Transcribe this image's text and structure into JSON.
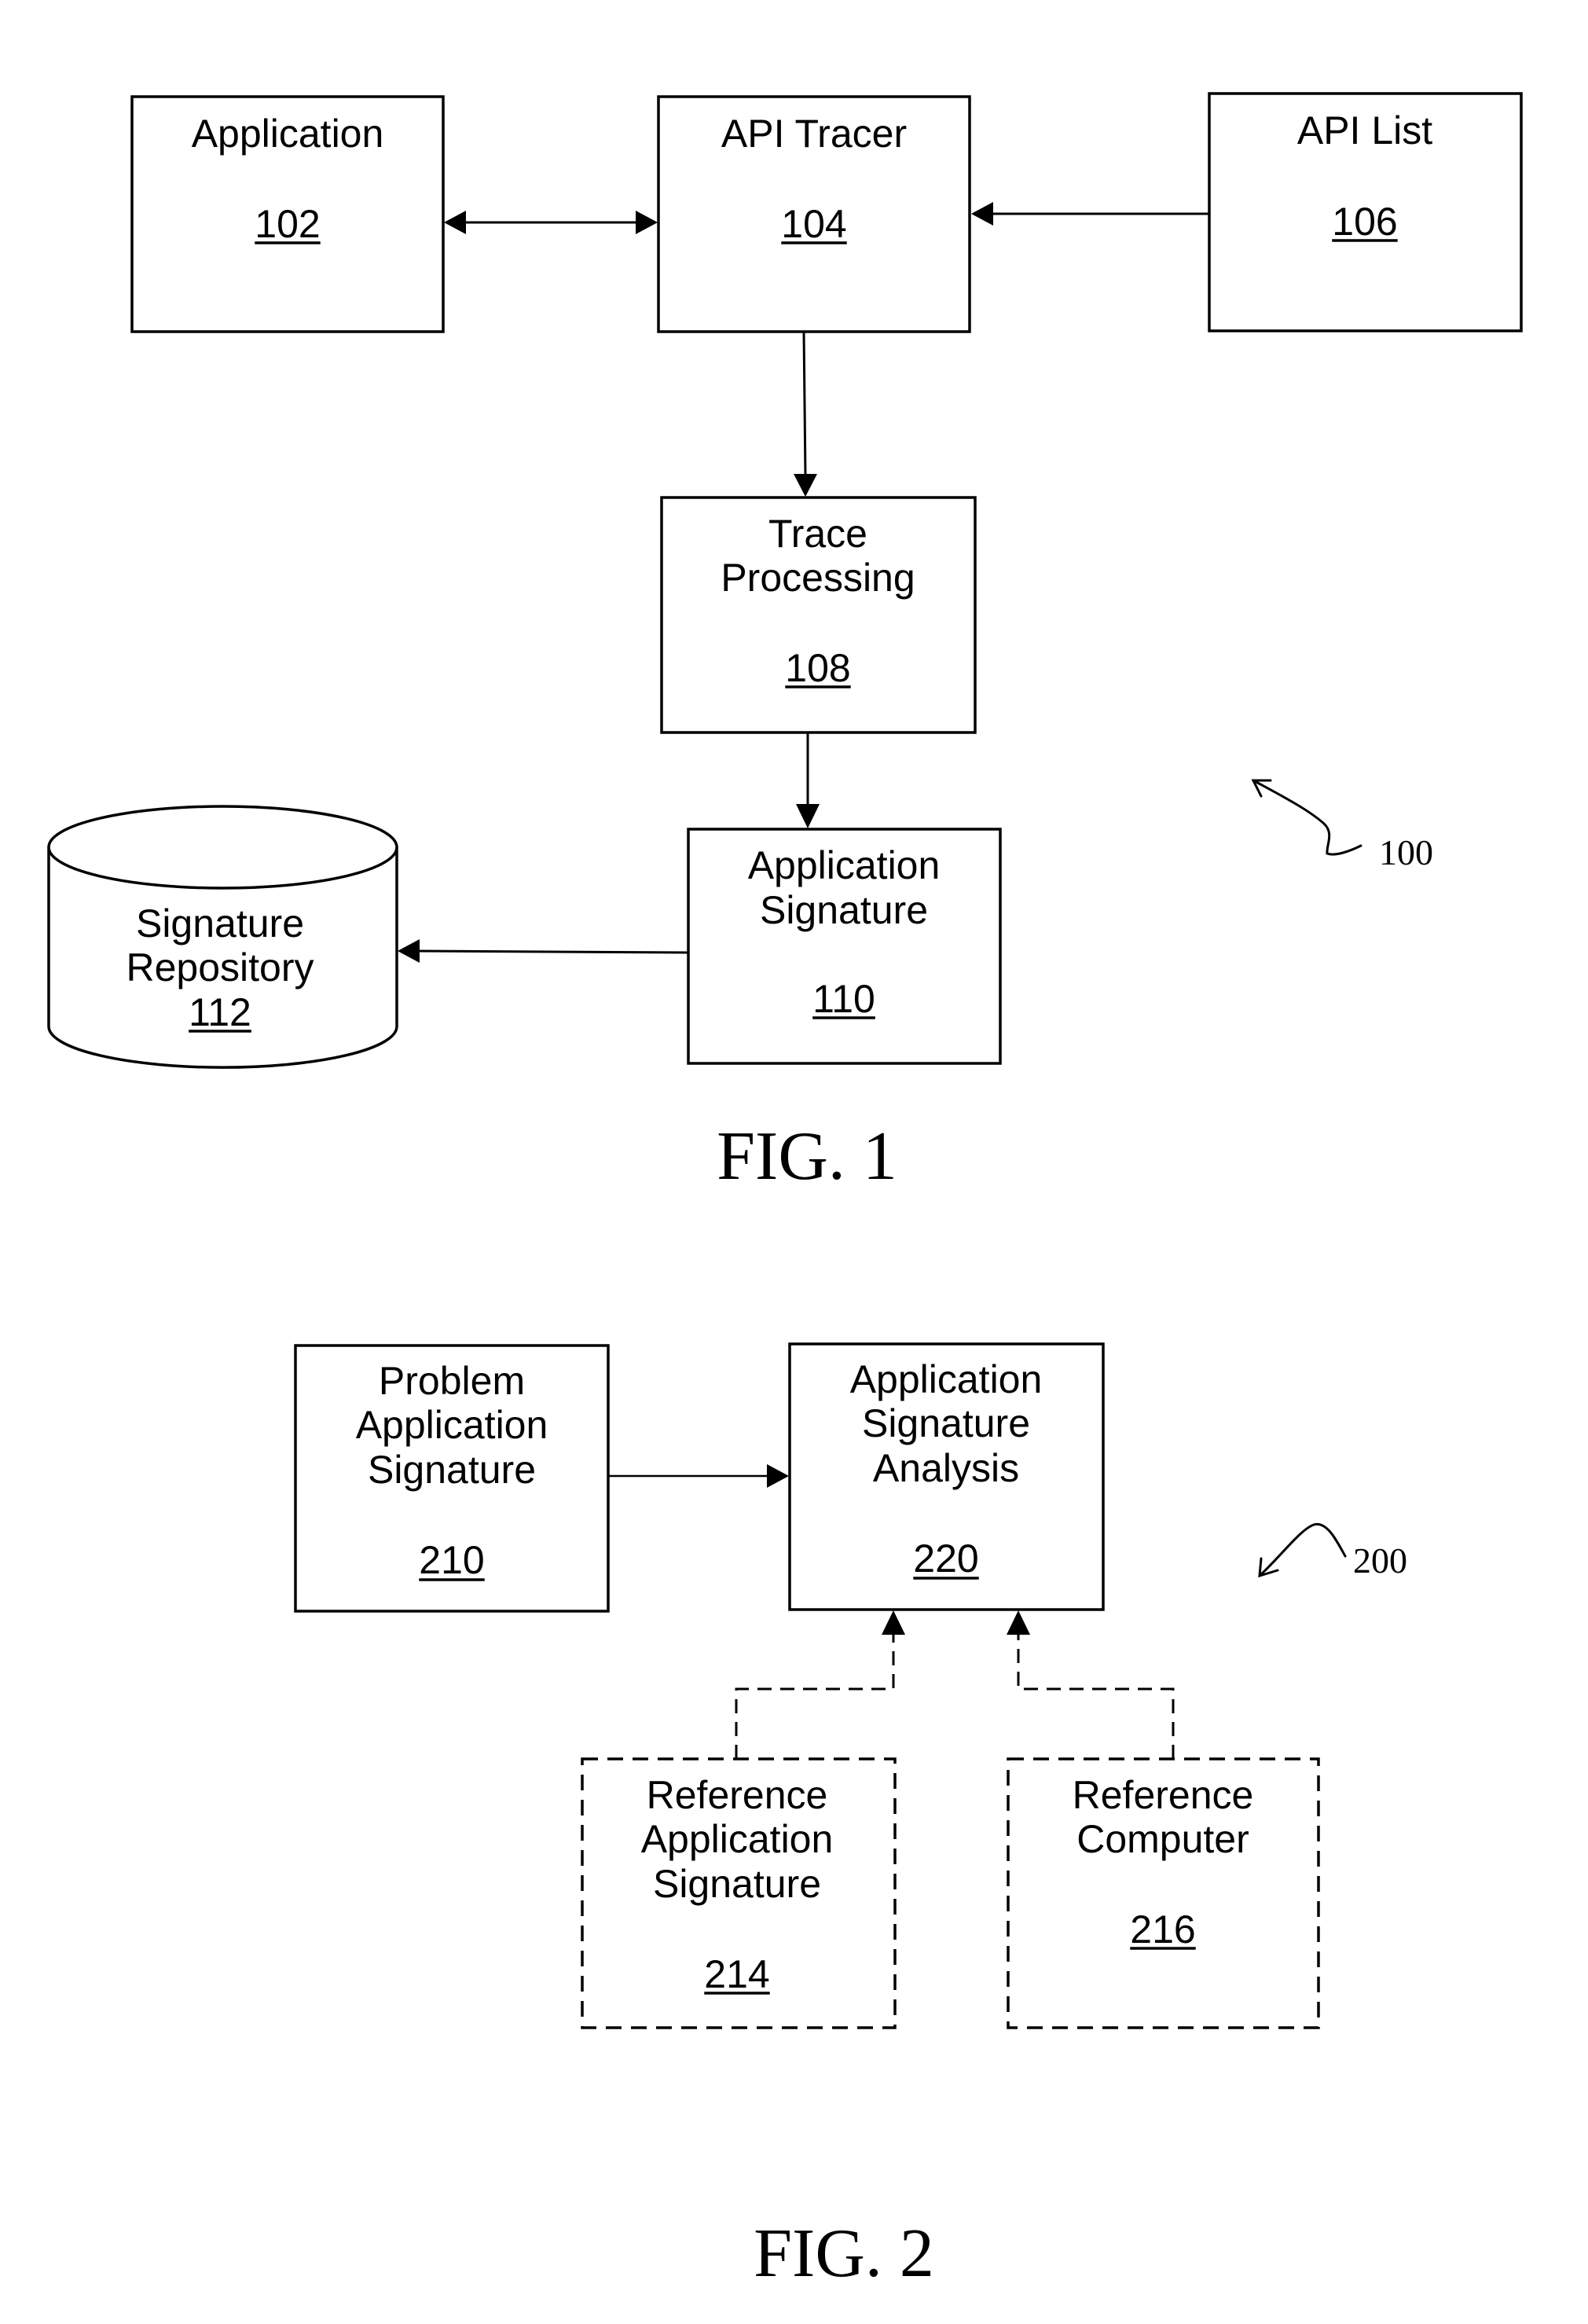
{
  "figure1": {
    "caption": "FIG. 1",
    "reference_label": "100",
    "nodes": [
      {
        "id": "application",
        "lines": [
          "Application"
        ],
        "number": "102",
        "shape": "rectangle",
        "border": "solid"
      },
      {
        "id": "api-tracer",
        "lines": [
          "API Tracer"
        ],
        "number": "104",
        "shape": "rectangle",
        "border": "solid"
      },
      {
        "id": "api-list",
        "lines": [
          "API List"
        ],
        "number": "106",
        "shape": "rectangle",
        "border": "solid"
      },
      {
        "id": "trace-processing",
        "lines": [
          "Trace",
          "Processing"
        ],
        "number": "108",
        "shape": "rectangle",
        "border": "solid"
      },
      {
        "id": "application-signature",
        "lines": [
          "Application",
          "Signature"
        ],
        "number": "110",
        "shape": "rectangle",
        "border": "solid"
      },
      {
        "id": "signature-repository",
        "lines": [
          "Signature",
          "Repository"
        ],
        "number": "112",
        "shape": "cylinder",
        "border": "solid"
      }
    ],
    "edges": [
      {
        "from": "application",
        "to": "api-tracer",
        "direction": "bidirectional",
        "style": "solid"
      },
      {
        "from": "api-list",
        "to": "api-tracer",
        "direction": "forward",
        "style": "solid"
      },
      {
        "from": "api-tracer",
        "to": "trace-processing",
        "direction": "forward",
        "style": "solid"
      },
      {
        "from": "trace-processing",
        "to": "application-signature",
        "direction": "forward",
        "style": "solid"
      },
      {
        "from": "application-signature",
        "to": "signature-repository",
        "direction": "forward",
        "style": "solid"
      }
    ]
  },
  "figure2": {
    "caption": "FIG. 2",
    "reference_label": "200",
    "nodes": [
      {
        "id": "problem-application-signature",
        "lines": [
          "Problem",
          "Application",
          "Signature"
        ],
        "number": "210",
        "shape": "rectangle",
        "border": "solid"
      },
      {
        "id": "application-signature-analysis",
        "lines": [
          "Application",
          "Signature",
          "Analysis"
        ],
        "number": "220",
        "shape": "rectangle",
        "border": "solid"
      },
      {
        "id": "reference-application-signature",
        "lines": [
          "Reference",
          "Application",
          "Signature"
        ],
        "number": "214",
        "shape": "rectangle",
        "border": "dashed"
      },
      {
        "id": "reference-computer",
        "lines": [
          "Reference",
          "Computer"
        ],
        "number": "216",
        "shape": "rectangle",
        "border": "dashed"
      }
    ],
    "edges": [
      {
        "from": "problem-application-signature",
        "to": "application-signature-analysis",
        "direction": "forward",
        "style": "solid"
      },
      {
        "from": "reference-application-signature",
        "to": "application-signature-analysis",
        "direction": "forward",
        "style": "dashed"
      },
      {
        "from": "reference-computer",
        "to": "application-signature-analysis",
        "direction": "forward",
        "style": "dashed"
      }
    ]
  }
}
